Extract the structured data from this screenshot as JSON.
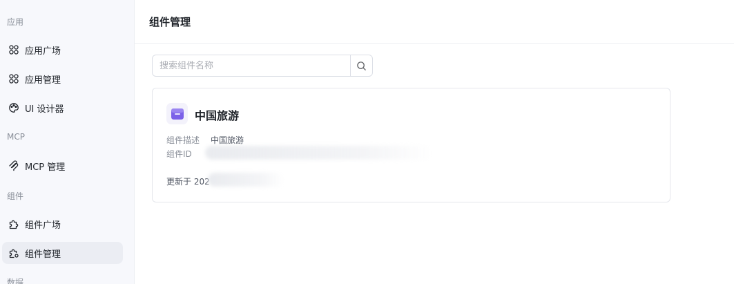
{
  "sidebar": {
    "groups": [
      {
        "title": "应用",
        "items": [
          {
            "label": "应用广场",
            "icon": "grid-icon"
          },
          {
            "label": "应用管理",
            "icon": "grid-icon"
          },
          {
            "label": "UI 设计器",
            "icon": "palette-icon"
          }
        ]
      },
      {
        "title": "MCP",
        "items": [
          {
            "label": "MCP 管理",
            "icon": "mcp-icon"
          }
        ]
      },
      {
        "title": "组件",
        "items": [
          {
            "label": "组件广场",
            "icon": "puzzle-icon"
          },
          {
            "label": "组件管理",
            "icon": "puzzle-settings-icon",
            "active": true
          }
        ]
      },
      {
        "title": "数据",
        "items": []
      }
    ]
  },
  "header": {
    "title": "组件管理"
  },
  "search": {
    "placeholder": "搜索组件名称",
    "value": ""
  },
  "card": {
    "name": "中国旅游",
    "desc_label": "组件描述",
    "desc_value": "中国旅游",
    "id_label": "组件ID",
    "updated_prefix": "更新于 202",
    "logo_color": "#7b61e8"
  },
  "colors": {
    "accent": "#7b61e8",
    "sidebar_bg": "#f7f8fc",
    "active_bg": "#ebedf3"
  }
}
